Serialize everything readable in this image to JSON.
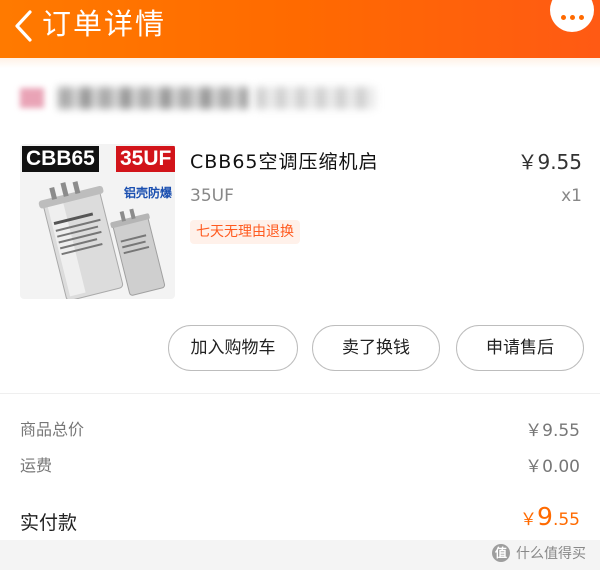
{
  "header": {
    "title": "订单详情",
    "back_icon": "chevron-left-icon",
    "more_icon": "more-dots-icon",
    "accent": "#ff6a00"
  },
  "product": {
    "image_tag_left": "CBB65",
    "image_tag_right": "35UF",
    "image_feature_text": "铝壳防爆",
    "title": "CBB65空调压缩机启",
    "price": "￥9.55",
    "spec": "35UF",
    "quantity": "x1",
    "return_badge": "七天无理由退换"
  },
  "actions": {
    "add_to_cart": "加入购物车",
    "resell": "卖了换钱",
    "after_sales": "申请售后"
  },
  "summary": {
    "goods_total_label": "商品总价",
    "goods_total_value": "￥9.55",
    "freight_label": "运费",
    "freight_value": "￥0.00",
    "paid_label": "实付款",
    "paid_currency": "￥",
    "paid_integer": "9",
    "paid_decimal": ".55"
  },
  "watermark": {
    "icon_text": "值",
    "text": "什么值得买"
  }
}
